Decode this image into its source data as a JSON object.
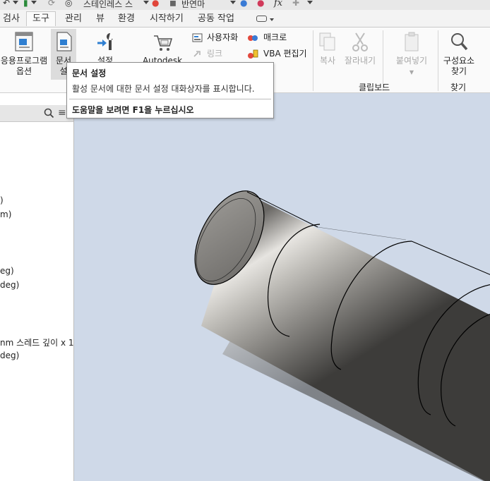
{
  "quick_access": {
    "material": "스테인레스 스",
    "appearance": "반연마",
    "formula_icon": "fx"
  },
  "tabs": [
    {
      "label": "검사"
    },
    {
      "label": "도구"
    },
    {
      "label": "관리"
    },
    {
      "label": "뷰"
    },
    {
      "label": "환경"
    },
    {
      "label": "시작하기"
    },
    {
      "label": "공동 작업"
    }
  ],
  "ribbon": {
    "app_options": {
      "line1": "응용프로그램",
      "line2": "옵션"
    },
    "doc_settings": {
      "line1": "문서",
      "line2": "설"
    },
    "settings": {
      "label": "설정"
    },
    "autodesk": {
      "label": "Autodesk"
    },
    "customize": {
      "label": "사용자화"
    },
    "macro": {
      "label": "매크로"
    },
    "link": {
      "label": "링크"
    },
    "vba": {
      "label": "VBA 편집기"
    },
    "copy": {
      "label": "복사"
    },
    "cut": {
      "label": "잘라내기"
    },
    "paste": {
      "label": "붙여넣기"
    },
    "find": {
      "line1": "구성요소",
      "line2": "찾기"
    },
    "clipboard_group": "클립보드",
    "find_group": "찾기"
  },
  "tooltip": {
    "title": "문서 설정",
    "description": "활성 문서에 대한 문서 설정 대화상자를 표시합니다.",
    "help": "도움말을 보려면 F1을 누르십시오"
  },
  "browser": {
    "items": [
      {
        "text": ")"
      },
      {
        "text": "m)"
      },
      {
        "text": "eg)"
      },
      {
        "text": "deg)"
      },
      {
        "text": "nm 스레드 깊이 x 1"
      },
      {
        "text": "deg)"
      }
    ]
  },
  "colors": {
    "viewport_bg": "#cfd9e8",
    "ribbon_bg": "#fafafa",
    "tab_bar_bg": "#f3f3f3",
    "accent_blue": "#2f7fd1"
  },
  "icons": [
    "search-icon",
    "wrench-icon",
    "cart-icon",
    "scissors-icon",
    "clipboard-icon",
    "magnifier-icon",
    "macro-icon",
    "vba-icon",
    "link-icon",
    "customize-icon"
  ]
}
